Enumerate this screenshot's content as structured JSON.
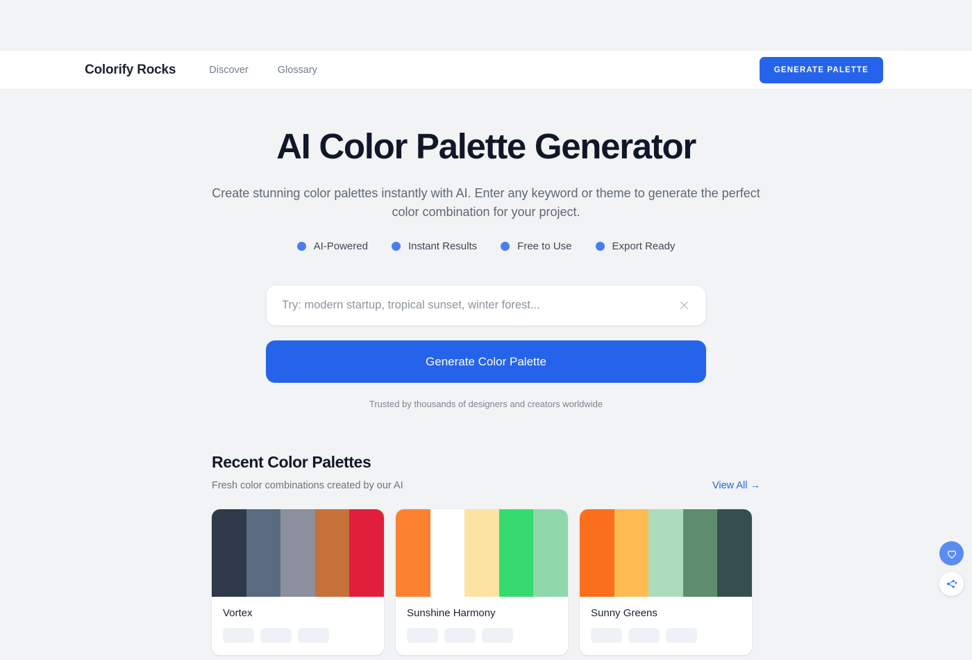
{
  "header": {
    "brand": "Colorify Rocks",
    "nav": [
      {
        "label": "Discover"
      },
      {
        "label": "Glossary"
      }
    ],
    "cta_label": "GENERATE PALETTE",
    "accent_color": "#2563eb"
  },
  "hero": {
    "title": "AI Color Palette Generator",
    "subtitle": "Create stunning color palettes instantly with AI. Enter any keyword or theme to generate the perfect color combination for your project.",
    "badges": [
      {
        "label": "AI-Powered",
        "dot_color": "#4a7ef0"
      },
      {
        "label": "Instant Results",
        "dot_color": "#4a7ef0"
      },
      {
        "label": "Free to Use",
        "dot_color": "#4a7ef0"
      },
      {
        "label": "Export Ready",
        "dot_color": "#4a7ef0"
      }
    ],
    "search": {
      "value": "",
      "placeholder": "Try: modern startup, tropical sunset, winter forest...",
      "clear_icon": "close-icon"
    },
    "cta_label": "Generate Color Palette",
    "trusted_text": "Trusted by thousands of designers and creators worldwide"
  },
  "recent": {
    "title": "Recent Color Palettes",
    "subtitle": "Fresh color combinations created by our AI",
    "view_all_label": "View All →",
    "cards": [
      {
        "name": "Vortex",
        "colors": [
          "#2e3949",
          "#5a6b80",
          "#8b909c",
          "#c5713a",
          "#e01f3d"
        ]
      },
      {
        "name": "Sunshine Harmony",
        "colors": [
          "#fb8230",
          "#fdb košice",
          "#fde3a3",
          "#35db6e",
          "#8fd8ab"
        ]
      },
      {
        "name": "Sunny Greens",
        "colors": [
          "#fb6f1c",
          "#ffbc52",
          "#addbbe",
          "#5d8d6d",
          "#34504e"
        ]
      }
    ]
  },
  "fabs": [
    {
      "name": "like-button",
      "icon": "heart-icon",
      "background": "#5b8def"
    },
    {
      "name": "share-button",
      "icon": "share-plus-icon",
      "background": "#ffffff"
    }
  ]
}
